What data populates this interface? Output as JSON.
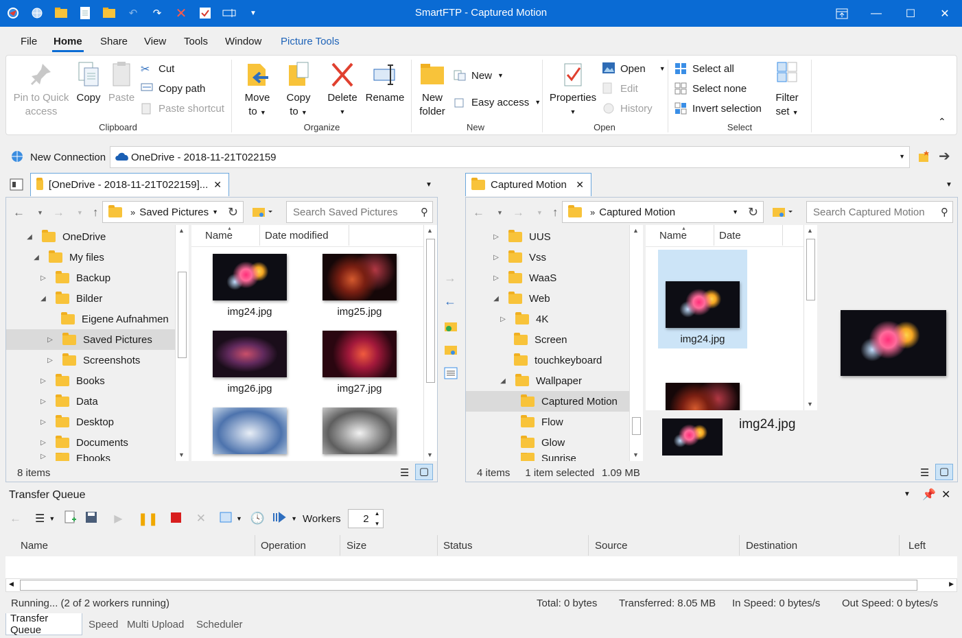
{
  "window": {
    "title": "SmartFTP - Captured Motion",
    "qat_icons": [
      "app-globe-icon",
      "globe-icon",
      "folder-open-icon",
      "page-icon",
      "folder-icon",
      "undo-icon",
      "redo-icon",
      "delete-x-icon",
      "checkmark-icon",
      "rename-icon",
      "qat-dropdown-icon"
    ]
  },
  "menu": {
    "tabs": [
      "File",
      "Home",
      "Share",
      "View",
      "Tools",
      "Window",
      "Picture Tools"
    ],
    "active": "Home"
  },
  "ribbon": {
    "clipboard": {
      "label": "Clipboard",
      "pin_line1": "Pin to Quick",
      "pin_line2": "access",
      "copy": "Copy",
      "paste": "Paste",
      "cut": "Cut",
      "copy_path": "Copy path",
      "paste_shortcut": "Paste shortcut"
    },
    "organize": {
      "label": "Organize",
      "move_line1": "Move",
      "move_line2": "to",
      "copy_line1": "Copy",
      "copy_line2": "to",
      "delete": "Delete",
      "rename": "Rename"
    },
    "new": {
      "label": "New",
      "new_folder_line1": "New",
      "new_folder_line2": "folder",
      "new_item": "New",
      "easy_access": "Easy access"
    },
    "open": {
      "label": "Open",
      "properties": "Properties",
      "open": "Open",
      "edit": "Edit",
      "history": "History"
    },
    "select": {
      "label": "Select",
      "select_all": "Select all",
      "select_none": "Select none",
      "invert_selection": "Invert selection",
      "filter_line1": "Filter",
      "filter_line2": "set"
    }
  },
  "address": {
    "new_connection": "New Connection",
    "current": "OneDrive - 2018-11-21T022159"
  },
  "left_pane": {
    "tab_label": "[OneDrive - 2018-11-21T022159]...",
    "path": "Saved Pictures",
    "search_placeholder": "Search Saved Pictures",
    "col_name": "Name",
    "col_date": "Date modified",
    "tree": [
      {
        "label": "OneDrive",
        "toggle": "◢"
      },
      {
        "label": "My files",
        "toggle": "◢"
      },
      {
        "label": "Backup",
        "toggle": "▷"
      },
      {
        "label": "Bilder",
        "toggle": "◢"
      },
      {
        "label": "Eigene Aufnahmen",
        "toggle": ""
      },
      {
        "label": "Saved Pictures",
        "toggle": "▷"
      },
      {
        "label": "Screenshots",
        "toggle": "▷"
      },
      {
        "label": "Books",
        "toggle": "▷"
      },
      {
        "label": "Data",
        "toggle": "▷"
      },
      {
        "label": "Desktop",
        "toggle": "▷"
      },
      {
        "label": "Documents",
        "toggle": "▷"
      },
      {
        "label": "Ebooks",
        "toggle": "▷"
      }
    ],
    "files": [
      "img24.jpg",
      "img25.jpg",
      "img26.jpg",
      "img27.jpg",
      "",
      ""
    ],
    "status": "8 items"
  },
  "right_pane": {
    "tab_label": "Captured Motion",
    "path": "Captured Motion",
    "search_placeholder": "Search Captured Motion",
    "col_name": "Name",
    "col_date": "Date",
    "tree": [
      {
        "label": "UUS",
        "toggle": "▷"
      },
      {
        "label": "Vss",
        "toggle": "▷"
      },
      {
        "label": "WaaS",
        "toggle": "▷"
      },
      {
        "label": "Web",
        "toggle": "◢"
      },
      {
        "label": "4K",
        "toggle": "▷"
      },
      {
        "label": "Screen",
        "toggle": ""
      },
      {
        "label": "touchkeyboard",
        "toggle": ""
      },
      {
        "label": "Wallpaper",
        "toggle": "◢"
      },
      {
        "label": "Captured Motion",
        "toggle": ""
      },
      {
        "label": "Flow",
        "toggle": ""
      },
      {
        "label": "Glow",
        "toggle": ""
      },
      {
        "label": "Sunrise",
        "toggle": ""
      }
    ],
    "files": [
      "img24.jpg"
    ],
    "preview_name": "img24.jpg",
    "status_items": "4 items",
    "status_selected": "1 item selected",
    "status_size": "1.09 MB"
  },
  "transfer_queue": {
    "title": "Transfer Queue",
    "workers_label": "Workers",
    "workers_value": "2",
    "columns": [
      "Name",
      "Operation",
      "Size",
      "Status",
      "Source",
      "Destination",
      "Left"
    ],
    "status": {
      "running": "Running... (2 of 2 workers running)",
      "total": "Total: 0 bytes",
      "transferred": "Transferred: 8.05 MB",
      "in_speed": "In Speed: 0 bytes/s",
      "out_speed": "Out Speed: 0 bytes/s"
    },
    "bottom_tabs": [
      "Transfer Queue",
      "Speed",
      "Multi Upload",
      "Scheduler"
    ]
  },
  "colors": {
    "titlebar": "#0a6bd4",
    "accent": "#0a6bd4",
    "selection": "#cce4f7"
  }
}
